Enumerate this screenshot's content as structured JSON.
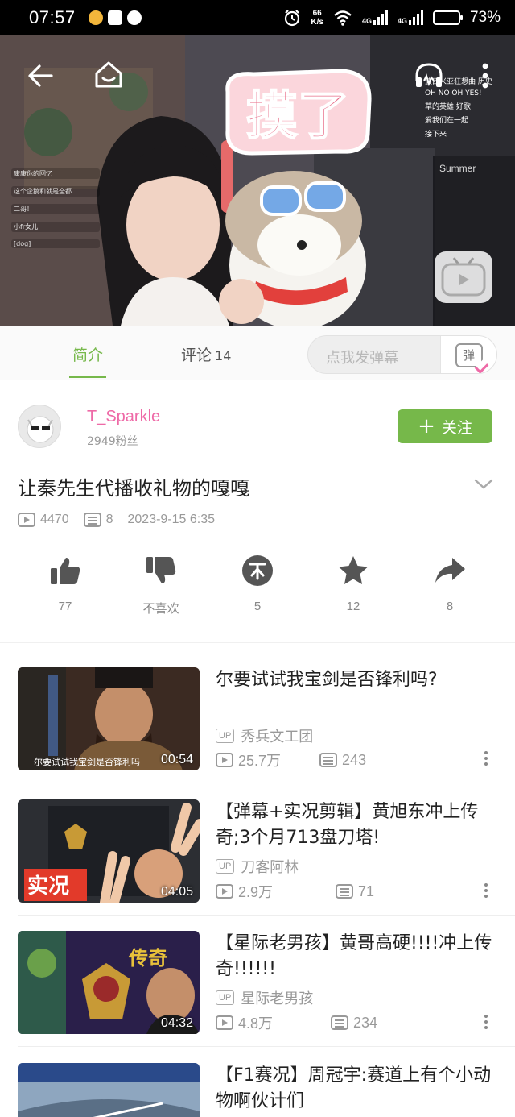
{
  "status_bar": {
    "time": "07:57",
    "net_speed_value": "66",
    "net_speed_unit": "K/s",
    "net_type_1": "4G",
    "net_type_2": "4G",
    "battery_percent": "73%",
    "battery_level": 0.73
  },
  "video": {
    "sticker_text": "摸了",
    "song_title": "Summer",
    "chat_right": [
      "波西米亚狂想曲  历史",
      "OH NO OH YES!",
      "草的英雄 好歌",
      "爱我们在一起",
      "接下来"
    ],
    "chat_left": [
      "康康你的回忆",
      "这个企鹅和就是全都",
      "二哥！",
      "小fr女儿",
      "[dog]"
    ]
  },
  "tabs": {
    "intro": "简介",
    "comments": "评论",
    "comments_count": "14",
    "danmaku_placeholder": "点我发弹幕",
    "danmaku_button": "弹"
  },
  "uploader": {
    "name": "T_Sparkle",
    "fans": "2949粉丝",
    "follow_label": "关注"
  },
  "video_info": {
    "title": "让秦先生代播收礼物的嘎嘎",
    "views": "4470",
    "danmaku": "8",
    "date": "2023-9-15 6:35"
  },
  "actions": {
    "like": "77",
    "dislike": "不喜欢",
    "coin": "5",
    "favorite": "12",
    "share": "8"
  },
  "related": [
    {
      "title": "尔要试试我宝剑是否锋利吗?",
      "uploader": "秀兵文工团",
      "views": "25.7万",
      "danmaku": "243",
      "duration": "00:54",
      "caption": "尔要试试我宝剑是否锋利吗"
    },
    {
      "title": "【弹幕+实况剪辑】黄旭东冲上传奇;3个月713盘刀塔!",
      "uploader": "刀客阿林",
      "views": "2.9万",
      "danmaku": "71",
      "duration": "04:05",
      "caption": "实况"
    },
    {
      "title": "【星际老男孩】黄哥高硬!!!!冲上传奇!!!!!!",
      "uploader": "星际老男孩",
      "views": "4.8万",
      "danmaku": "234",
      "duration": "04:32",
      "caption": "传奇"
    },
    {
      "title": "【F1赛况】周冠宇:赛道上有个小动物啊伙计们",
      "uploader": "",
      "views": "",
      "danmaku": "",
      "duration": "",
      "caption": ""
    }
  ],
  "colors": {
    "accent_green": "#76b84a",
    "uploader_pink": "#ee6aa7"
  },
  "icons": [
    "back-icon",
    "home-icon",
    "headphones-icon",
    "more-icon",
    "like-icon",
    "dislike-icon",
    "coin-icon",
    "star-icon",
    "share-icon",
    "play-count-icon",
    "danmaku-count-icon",
    "chevron-down-icon"
  ]
}
